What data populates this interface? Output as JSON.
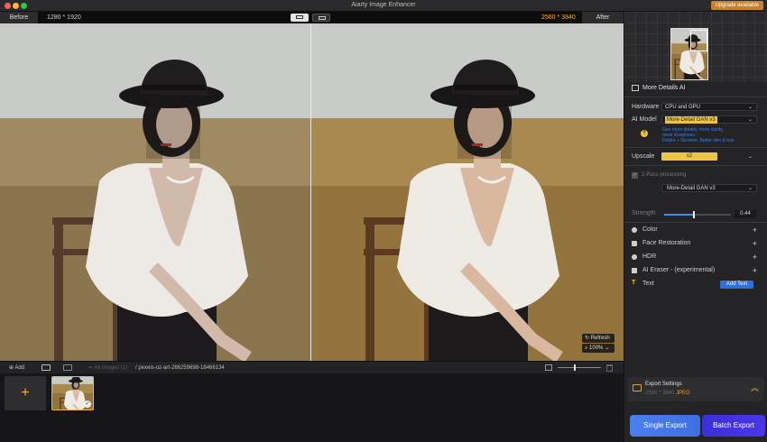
{
  "window": {
    "title": "Aiarty Image Enhancer",
    "upgrade_label": "Upgrade available"
  },
  "compare": {
    "before_label": "Before",
    "before_resolution": "1280 * 1920",
    "after_resolution": "2560 * 3840",
    "after_label": "After"
  },
  "canvas": {
    "refresh_label": "Refresh",
    "zoom_label": "100%",
    "zoom_arrow": "⌄"
  },
  "bottombar": {
    "add_label": "Add",
    "all_images_label": "All Images (1)",
    "file_path": "/ pexels-oz-art-266259698-18466134"
  },
  "strip": {
    "add_symbol": "+",
    "check_symbol": "✓"
  },
  "panel": {
    "more_details_title": "More Details AI",
    "hardware_label": "Hardware",
    "hardware_value": "CPU and GPU",
    "ai_model_label": "AI Model",
    "ai_model_value": "More-Detail GAN  v3",
    "ai_model_desc_1": "Gen more details, more clarity,",
    "ai_model_desc_2": "more sharpness.",
    "ai_model_desc_3": "Deblur + Denoise. Better skin & hair",
    "help_symbol": "?",
    "upscale_label": "Upscale",
    "upscale_value": "x2",
    "two_pass_label": "2-Pass processing",
    "two_pass_model": "More-Detail GAN  v3",
    "strength_label": "Strength",
    "strength_value": "0.44",
    "strength_level": 0.44,
    "effects": [
      {
        "label": "Color"
      },
      {
        "label": "Face Restoration"
      },
      {
        "label": "HDR"
      },
      {
        "label": "AI Eraser - (experimental)"
      }
    ],
    "text_label": "Text",
    "add_text_label": "Add Text",
    "plus_symbol": "+",
    "chevron": "⌄"
  },
  "export": {
    "settings_title": "Export Settings",
    "settings_resolution": "2560 * 3840",
    "settings_format": "JPEG",
    "settings_chevron": "︽",
    "single_label": "Single Export",
    "batch_label": "Batch Export"
  },
  "colors": {
    "accent": "#f0b23c",
    "blue": "#3f6fe0",
    "purple": "#3b2fd8"
  }
}
